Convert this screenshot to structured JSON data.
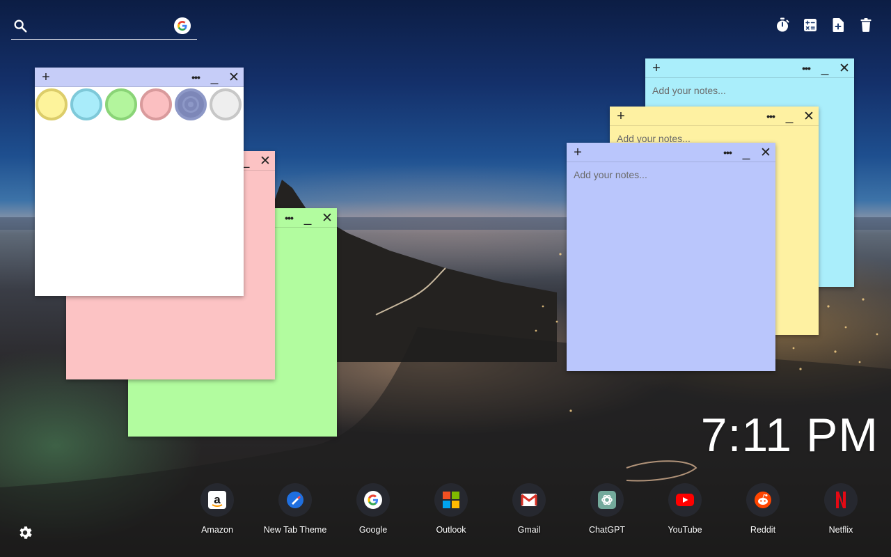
{
  "search": {
    "placeholder": "",
    "provider_icon": "google-icon"
  },
  "toolbar": {
    "icons": [
      "timer-icon",
      "calculator-icon",
      "add-note-icon",
      "trash-icon"
    ]
  },
  "notes": {
    "white_note": {
      "color": "#ffffff",
      "header_color": "#c6cdf8",
      "palette": [
        {
          "name": "yellow",
          "fill": "#fdf39b",
          "ring": "#dccd6a"
        },
        {
          "name": "cyan",
          "fill": "#a9ecfa",
          "ring": "#7ec9d9"
        },
        {
          "name": "green",
          "fill": "#b3f59d",
          "ring": "#8ad477"
        },
        {
          "name": "pink",
          "fill": "#fbbfc1",
          "ring": "#d99a9c"
        },
        {
          "name": "blue",
          "fill": "#b8c2f7",
          "ring": "#8d98c7",
          "selected": true
        },
        {
          "name": "gray",
          "fill": "#eeeeee",
          "ring": "#c7c7c7"
        }
      ]
    },
    "pink_note": {
      "color": "#fcc3c4"
    },
    "green_note": {
      "color": "#b2fc9f"
    },
    "cyan_note": {
      "color": "#aaeefb",
      "placeholder": "Add your notes..."
    },
    "yellow_note": {
      "color": "#fef1a2",
      "placeholder": "Add your notes..."
    },
    "blue_note": {
      "color": "#bac6fc",
      "placeholder": "Add your notes..."
    },
    "buttons": {
      "add": "+",
      "more": "•••",
      "minimize": "_",
      "close": "✕"
    }
  },
  "clock": {
    "time": "7:11 PM"
  },
  "shortcuts": [
    {
      "label": "Amazon",
      "icon": "amazon-icon"
    },
    {
      "label": "New Tab Theme",
      "icon": "new-tab-theme-icon"
    },
    {
      "label": "Google",
      "icon": "google-icon"
    },
    {
      "label": "Outlook",
      "icon": "outlook-icon"
    },
    {
      "label": "Gmail",
      "icon": "gmail-icon"
    },
    {
      "label": "ChatGPT",
      "icon": "chatgpt-icon"
    },
    {
      "label": "YouTube",
      "icon": "youtube-icon"
    },
    {
      "label": "Reddit",
      "icon": "reddit-icon"
    },
    {
      "label": "Netflix",
      "icon": "netflix-icon"
    }
  ],
  "settings": {
    "icon": "gear-icon"
  }
}
